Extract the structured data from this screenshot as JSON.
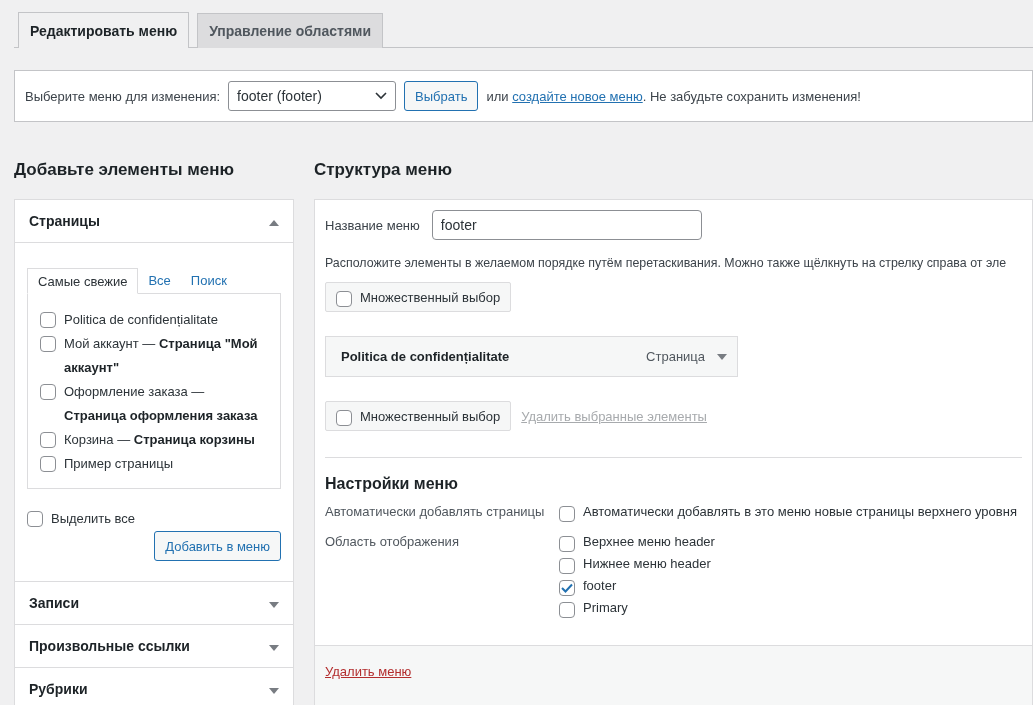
{
  "tabs": [
    {
      "label": "Редактировать меню",
      "selected": true
    },
    {
      "label": "Управление областями",
      "selected": false
    }
  ],
  "menu_select": {
    "label": "Выберите меню для изменения:",
    "value": "footer (footer)",
    "button": "Выбрать",
    "before_link": "или ",
    "link": "создайте новое меню",
    "after_link": ". Не забудьте сохранить изменения!"
  },
  "add_items": {
    "heading": "Добавьте элементы меню",
    "sections": [
      {
        "title": "Страницы",
        "expanded": true,
        "subtabs": [
          {
            "label": "Самые свежие",
            "selected": true
          },
          {
            "label": "Все",
            "selected": false
          },
          {
            "label": "Поиск",
            "selected": false
          }
        ],
        "items": [
          {
            "label": "Politica de confidențialitate",
            "checked": false
          },
          {
            "label": "Мой аккаунт — **Страница \"Мой аккаунт\"**",
            "checked": false
          },
          {
            "label": "Оформление заказа — **Страница оформления заказа**",
            "checked": false
          },
          {
            "label": "Корзина — **Страница корзины**",
            "checked": false
          },
          {
            "label": "Пример страницы",
            "checked": false
          }
        ],
        "select_all": {
          "label": "Выделить все",
          "checked": false
        },
        "add_button": "Добавить в меню"
      },
      {
        "title": "Записи",
        "expanded": false
      },
      {
        "title": "Произвольные ссылки",
        "expanded": false
      },
      {
        "title": "Рубрики",
        "expanded": false
      }
    ]
  },
  "structure": {
    "heading": "Структура меню",
    "name_label": "Название меню",
    "name_value": "footer",
    "instructions": "Расположите элементы в желаемом порядке путём перетаскивания. Можно также щёлкнуть на стрелку справа от эле",
    "bulk_select": [
      {
        "label": "Множественный выбор",
        "checked": false
      },
      {
        "label": "Множественный выбор",
        "checked": false
      }
    ],
    "menu_items": [
      {
        "title": "Politica de confidențialitate",
        "type": "Страница"
      }
    ],
    "delete_selected": "Удалить выбранные элементы",
    "settings": {
      "heading": "Настройки меню",
      "rows": [
        {
          "label": "Автоматически добавлять страницы",
          "options": [
            {
              "label": "Автоматически добавлять в это меню новые страницы верхнего уровня",
              "checked": false
            }
          ]
        },
        {
          "label": "Область отображения",
          "options": [
            {
              "label": "Верхнее меню header",
              "checked": false
            },
            {
              "label": "Нижнее меню header",
              "checked": false
            },
            {
              "label": "footer",
              "checked": true
            },
            {
              "label": "Primary",
              "checked": false
            }
          ]
        }
      ]
    },
    "delete_menu": "Удалить меню"
  }
}
